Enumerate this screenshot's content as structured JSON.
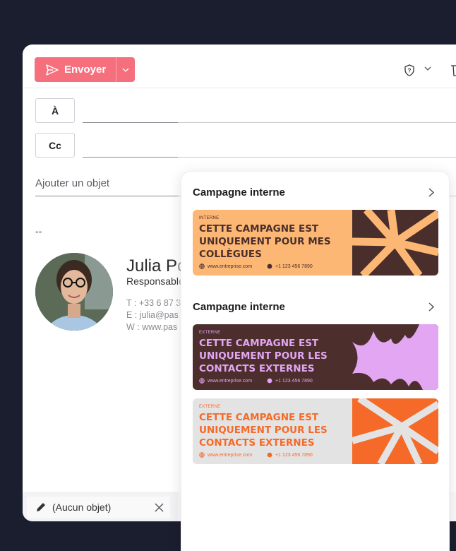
{
  "toolbar": {
    "send_label": "Envoyer"
  },
  "recipients": {
    "to_label": "À",
    "cc_label": "Cc"
  },
  "subject": {
    "placeholder": "Ajouter un objet"
  },
  "body": {
    "separator": "--"
  },
  "signature": {
    "name": "Julia Po",
    "role": "Responsable",
    "phone": "T : +33 6 87 3",
    "email": "E : julia@pas",
    "web": "W : www.pas"
  },
  "draft": {
    "label": "(Aucun objet)"
  },
  "panel": {
    "sections": [
      {
        "title": "Campagne interne",
        "banners": [
          {
            "tag": "INTERNE",
            "headline": "CETTE CAMPAGNE EST UNIQUEMENT POUR MES COLLÈGUES",
            "website": "www.entreprise.com",
            "phone": "+1 123 456 7890"
          }
        ]
      },
      {
        "title": "Campagne interne",
        "banners": [
          {
            "tag": "EXTERNE",
            "headline": "CETTE CAMPAGNE EST UNIQUEMENT POUR LES CONTACTS EXTERNES",
            "website": "www.entreprise.com",
            "phone": "+1 123 456 7890"
          },
          {
            "tag": "EXTERNE",
            "headline": "CETTE CAMPAGNE EST UNIQUEMENT POUR LES CONTACTS EXTERNES",
            "website": "www.entreprise.com",
            "phone": "+1 123 456 7890"
          }
        ]
      }
    ]
  },
  "colors": {
    "background": "#1b1e2e",
    "send_button": "#f56f7d",
    "banner_internal_bg": "#fdb774",
    "banner_internal_accent": "#4a2e2b",
    "banner_external1_bg": "#4c2e2c",
    "banner_external1_text": "#e2a6f2",
    "banner_external2_bg": "#e4e3e3",
    "banner_external2_text": "#f56a28"
  },
  "icons": [
    "send-icon",
    "chevron-down-icon",
    "shield-icon",
    "trash-icon",
    "pencil-icon",
    "close-icon",
    "chevron-right-icon",
    "globe-icon",
    "whatsapp-icon"
  ]
}
